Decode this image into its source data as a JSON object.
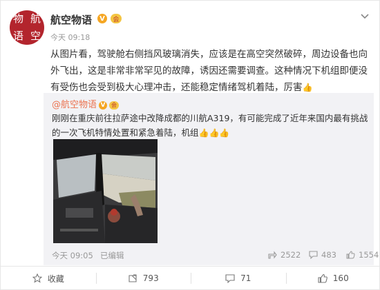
{
  "author": {
    "name": "航空物语",
    "avatar_chars": [
      "物",
      "航",
      "语",
      "空"
    ],
    "verified_badge": "V",
    "member_badge": "会",
    "time": "今天 09:18"
  },
  "post": {
    "text": "从图片看，驾驶舱右侧挡风玻璃消失，应该是在高空突然破碎，周边设备也向外飞出，这是非常非常罕见的故障，诱因还需要调查。这种情况下机组即便没有受伤也会受到极大心理冲击，还能稳定情绪驾机着陆，厉害",
    "thumb_icon": "thumbs-up-icon"
  },
  "repost": {
    "author": "@航空物语",
    "text": "刚刚在重庆前往拉萨途中改降成都的川航A319，有可能完成了近年来国内最有挑战的一次飞机特情处置和紧急着陆，机组",
    "time": "今天 09:05",
    "edit_label": "已编辑",
    "shares": "2522",
    "comments": "483",
    "likes": "1554"
  },
  "actions": {
    "favorite_label": "收藏",
    "repost_count": "793",
    "comment_count": "71",
    "like_count": "160"
  },
  "colors": {
    "accent": "#eb7350",
    "verified": "#f5a623",
    "avatar_bg": "#b3252d",
    "repost_bg": "#f2f2f5"
  }
}
